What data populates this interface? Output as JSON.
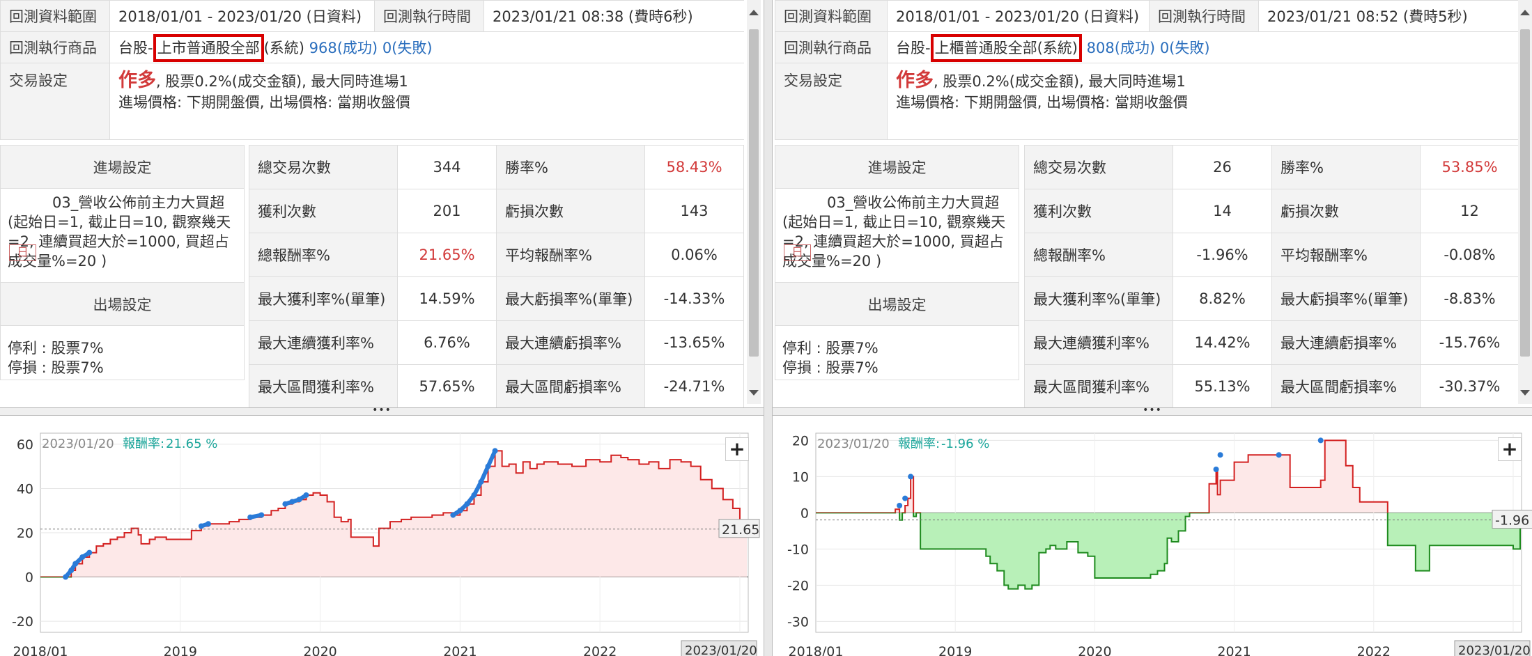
{
  "labels": {
    "range": "回測資料範圍",
    "exec_time": "回測執行時間",
    "product": "回測執行商品",
    "trade": "交易設定",
    "entry_hdr": "進場設定",
    "exit_hdr": "出場設定",
    "total_trades": "總交易次數",
    "win_rate": "勝率%",
    "win_count": "獲利次數",
    "loss_count": "虧損次數",
    "total_return": "總報酬率%",
    "avg_return": "平均報酬率%",
    "max_win": "最大獲利率%(單筆)",
    "max_loss": "最大虧損率%(單筆)",
    "max_consec_win": "最大連續獲利率%",
    "max_consec_loss": "最大連續虧損率%",
    "max_range_win": "最大區間獲利率%",
    "max_range_loss": "最大區間虧損率%",
    "return_label": "報酬率:",
    "buy": "作多",
    "trade_line1": ", 股票0.2%(成交金額), 最大同時進場1",
    "trade_line2": "進場價格: 下期開盤價, 出場價格: 當期收盤價",
    "day_tag": "日",
    "condition": "03_營收公佈前主力大買超(起始日=1, 截止日=10, 觀察幾天=2, 連續買超大於=1000, 買超占成交量%=20 )",
    "stop_profit": "停利 : 股票7%",
    "stop_loss": "停損 : 股票7%",
    "plus": "+",
    "splitter_dots": "•••"
  },
  "left": {
    "range": "2018/01/01 - 2023/01/20 (日資料)",
    "exec_time": "2023/01/21 08:38 (費時6秒)",
    "product_prefix": "台股",
    "product_dash": "-",
    "product_box": "上市普通股全部",
    "product_suffix": "(系統)",
    "success": "968(成功)",
    "fail": "0(失敗)",
    "total_trades": "344",
    "win_rate": "58.43%",
    "win_count": "201",
    "loss_count": "143",
    "total_return": "21.65%",
    "avg_return": "0.06%",
    "max_win": "14.59%",
    "max_loss": "-14.33%",
    "max_consec_win": "6.76%",
    "max_consec_loss": "-13.65%",
    "max_range_win": "57.65%",
    "max_range_loss": "-24.71%",
    "chart_date": "2023/01/20",
    "chart_return": "21.65 %",
    "end_value_label": "21.65",
    "cursor_date": "2023/01/20"
  },
  "right": {
    "range": "2018/01/01 - 2023/01/20 (日資料)",
    "exec_time": "2023/01/21 08:52 (費時5秒)",
    "product_prefix": "台股",
    "product_dash": "-",
    "product_box": "上櫃普通股全部(系統)",
    "success": "808(成功)",
    "fail": "0(失敗)",
    "total_trades": "26",
    "win_rate": "53.85%",
    "win_count": "14",
    "loss_count": "12",
    "total_return": "-1.96%",
    "avg_return": "-0.08%",
    "max_win": "8.82%",
    "max_loss": "-8.83%",
    "max_consec_win": "14.42%",
    "max_consec_loss": "-15.76%",
    "max_range_win": "55.13%",
    "max_range_loss": "-30.37%",
    "chart_date": "2023/01/20",
    "chart_return": "-1.96 %",
    "end_value_label": "-1.96",
    "cursor_date": "2023/01/20"
  },
  "colors": {
    "up_line": "#d32020",
    "up_fill": "#fde8e8",
    "down_line": "#1e8a1e",
    "down_fill": "#b8f0b8",
    "marker": "#2a7bd8",
    "return_text": "#1aa59a",
    "win_rate_red": "#d23a3a"
  },
  "chart_data": [
    {
      "type": "area",
      "x_ticks": [
        "2018/01",
        "2019",
        "2020",
        "2021",
        "2022",
        "2023"
      ],
      "y_ticks": [
        60,
        40,
        20,
        0,
        -20
      ],
      "ylim": [
        -25,
        65
      ],
      "xlim": [
        2018.0,
        2023.06
      ],
      "reference_line": 21.65,
      "series": [
        {
          "x": [
            2018.0,
            2018.18,
            2018.22,
            2018.25,
            2018.3,
            2018.35,
            2018.4,
            2018.45,
            2018.5,
            2018.55,
            2018.6,
            2018.65,
            2018.7,
            2018.72,
            2018.78,
            2018.82,
            2018.9,
            2019.0,
            2019.08,
            2019.15,
            2019.2,
            2019.28,
            2019.35,
            2019.42,
            2019.5,
            2019.58,
            2019.65,
            2019.7,
            2019.75,
            2019.8,
            2019.85,
            2019.9,
            2019.95,
            2020.0,
            2020.05,
            2020.1,
            2020.15,
            2020.2,
            2020.22,
            2020.35,
            2020.38,
            2020.42,
            2020.5,
            2020.58,
            2020.65,
            2020.72,
            2020.8,
            2020.88,
            2020.95,
            2021.0,
            2021.05,
            2021.1,
            2021.15,
            2021.2,
            2021.25,
            2021.3,
            2021.35,
            2021.4,
            2021.45,
            2021.5,
            2021.55,
            2021.6,
            2021.7,
            2021.8,
            2021.9,
            2022.0,
            2022.08,
            2022.15,
            2022.2,
            2022.28,
            2022.35,
            2022.42,
            2022.5,
            2022.58,
            2022.65,
            2022.72,
            2022.8,
            2022.88,
            2022.95,
            2023.0,
            2023.05
          ],
          "y": [
            0,
            0,
            3,
            6,
            9,
            11,
            14,
            15,
            17,
            18,
            20,
            22,
            19,
            15,
            17,
            18,
            17,
            17,
            21,
            23,
            24,
            24,
            25,
            26,
            27,
            28,
            30,
            31,
            33,
            34,
            35,
            37,
            38,
            37,
            34,
            27,
            25,
            26,
            18,
            18,
            14,
            22,
            25,
            26,
            27,
            27,
            28,
            29,
            28,
            30,
            33,
            37,
            43,
            50,
            57,
            50,
            51,
            47,
            52,
            49,
            51,
            52,
            51,
            50,
            53,
            52,
            55,
            54,
            53,
            51,
            52,
            49,
            53,
            52,
            50,
            44,
            40,
            35,
            31,
            25,
            22
          ],
          "marker_ranges": [
            [
              2018.18,
              2018.35
            ],
            [
              2019.1,
              2019.25
            ],
            [
              2019.45,
              2019.6
            ],
            [
              2019.75,
              2019.92
            ],
            [
              2020.9,
              2021.25
            ]
          ]
        }
      ]
    },
    {
      "type": "area",
      "x_ticks": [
        "2018/01",
        "2019",
        "2020",
        "2021",
        "2022",
        "2023"
      ],
      "y_ticks": [
        20,
        10,
        0,
        -10,
        -20,
        -30
      ],
      "ylim": [
        -33,
        22
      ],
      "xlim": [
        2018.0,
        2023.06
      ],
      "reference_line": -1.96,
      "series": [
        {
          "x": [
            2018.0,
            2018.55,
            2018.57,
            2018.6,
            2018.62,
            2018.64,
            2018.66,
            2018.68,
            2018.7,
            2018.72,
            2018.75,
            2019.2,
            2019.22,
            2019.25,
            2019.3,
            2019.35,
            2019.38,
            2019.42,
            2019.45,
            2019.5,
            2019.55,
            2019.6,
            2019.65,
            2019.68,
            2019.72,
            2019.8,
            2019.88,
            2019.95,
            2020.0,
            2020.1,
            2020.2,
            2020.3,
            2020.35,
            2020.4,
            2020.45,
            2020.5,
            2020.52,
            2020.55,
            2020.6,
            2020.65,
            2020.68,
            2020.72,
            2020.78,
            2020.82,
            2020.86,
            2020.87,
            2020.88,
            2020.9,
            2021.0,
            2021.1,
            2021.15,
            2021.2,
            2021.25,
            2021.3,
            2021.32,
            2021.4,
            2021.45,
            2021.5,
            2021.55,
            2021.6,
            2021.62,
            2021.65,
            2021.75,
            2021.8,
            2021.85,
            2021.9,
            2022.0,
            2022.1,
            2022.12,
            2022.2,
            2022.3,
            2022.4,
            2022.5,
            2022.6,
            2022.7,
            2022.8,
            2022.85,
            2022.9,
            2022.95,
            2023.0,
            2023.05
          ],
          "y": [
            0,
            0,
            1,
            -2,
            0,
            2,
            4,
            10,
            -1,
            0,
            -10,
            -10,
            -12,
            -14,
            -16,
            -20,
            -21,
            -21,
            -20,
            -21,
            -20,
            -11,
            -10,
            -9,
            -10,
            -8,
            -11,
            -12,
            -18,
            -18,
            -18,
            -18,
            -18,
            -17,
            -16,
            -14,
            -7,
            -8,
            -5,
            -1,
            0,
            0,
            0,
            8,
            8,
            12,
            5,
            9,
            14,
            16,
            16,
            16,
            16,
            16,
            16,
            7,
            7,
            7,
            7,
            7,
            9,
            20,
            20,
            13,
            7,
            3,
            3,
            -9,
            -9,
            -9,
            -16,
            -9,
            -9,
            -9,
            -9,
            -9,
            -9,
            -9,
            -9,
            -10,
            -2
          ],
          "marker_points": [
            [
              2018.6,
              2
            ],
            [
              2018.64,
              4
            ],
            [
              2018.68,
              10
            ],
            [
              2020.87,
              12
            ],
            [
              2020.9,
              16
            ],
            [
              2021.32,
              16
            ],
            [
              2021.62,
              20
            ]
          ]
        }
      ]
    }
  ]
}
